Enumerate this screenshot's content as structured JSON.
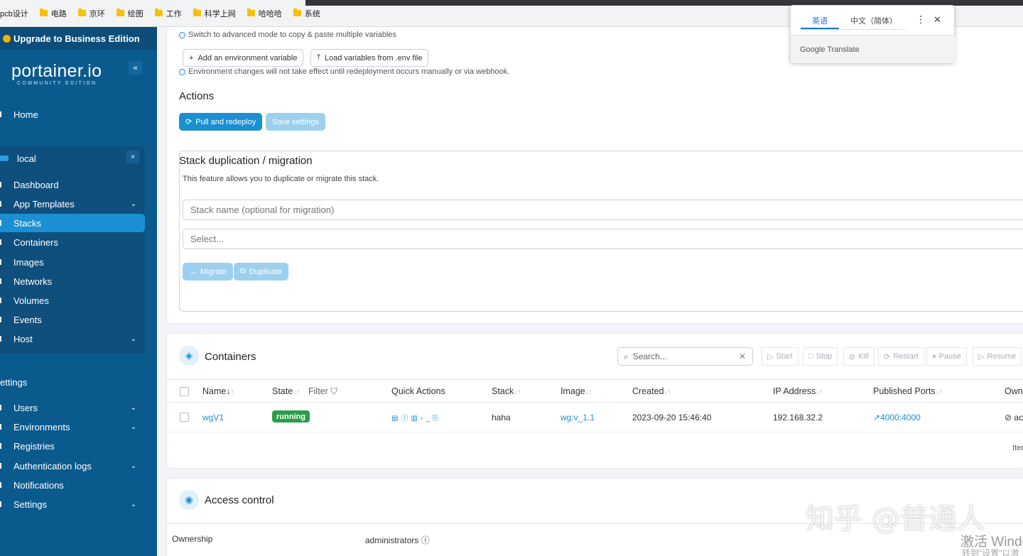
{
  "bookmarks": [
    "pcb设计",
    "电路",
    "京环",
    "绘图",
    "工作",
    "科学上网",
    "哈哈哈",
    "系统"
  ],
  "sidebar": {
    "upgrade": "Upgrade to Business Edition",
    "logo": "portainer.io",
    "logo_sub": "COMMUNITY EDITION",
    "collapse": "«",
    "home": "Home",
    "env": "local",
    "env_close": "×",
    "items": [
      "Dashboard",
      "App Templates",
      "Stacks",
      "Containers",
      "Images",
      "Networks",
      "Volumes",
      "Events",
      "Host"
    ],
    "settings_title": "ettings",
    "settings_items": [
      "Users",
      "Environments",
      "Registries",
      "Authentication logs",
      "Notifications",
      "Settings"
    ]
  },
  "editor": {
    "advanced_hint": "Switch to advanced mode to copy & paste multiple variables",
    "add_env": "Add an environment variable",
    "load_env": "Load variables from .env file",
    "env_hint": "Environment changes will not take effect until redeployment occurs manually or via webhook.",
    "actions_title": "Actions",
    "pull_redeploy": "Pull and redeploy",
    "save_settings": "Save settings",
    "dup_title": "Stack duplication / migration",
    "dup_desc": "This feature allows you to duplicate or migrate this stack.",
    "stack_name_placeholder": "Stack name (optional for migration)",
    "select_placeholder": "Select...",
    "migrate": "Migrate",
    "duplicate": "Duplicate"
  },
  "containers": {
    "title": "Containers",
    "search_placeholder": "Search...",
    "actions": [
      "Start",
      "Stop",
      "Kill",
      "Restart",
      "Pause",
      "Resume"
    ],
    "headers": {
      "name": "Name",
      "state": "State",
      "filter": "Filter",
      "quick_actions": "Quick Actions",
      "stack": "Stack",
      "image": "Image",
      "created": "Created",
      "ip": "IP Address",
      "ports": "Published Ports",
      "owner": "Own"
    },
    "row": {
      "name": "wgV1",
      "state": "running",
      "stack": "haha",
      "image": "wg:v_1.1",
      "created": "2023-09-20 15:46:40",
      "ip": "192.168.32.2",
      "ports": "4000:4000",
      "owner": "ac"
    },
    "items_label": "Iter"
  },
  "access": {
    "title": "Access control",
    "ownership_label": "Ownership",
    "ownership_value": "administrators"
  },
  "translate": {
    "tab1": "英语",
    "tab2": "中文（简体）",
    "menu": "⋮",
    "close": "✕",
    "footer": "Google Translate"
  },
  "overlay": {
    "watermark": "知乎 @普通人",
    "windows": "激活 Windo",
    "windows_sub": "转到\"设置\"以激"
  },
  "colors": {
    "sidebar": "#0b5a8e",
    "accent": "#1a8fd1",
    "running": "#2a9d4b"
  }
}
